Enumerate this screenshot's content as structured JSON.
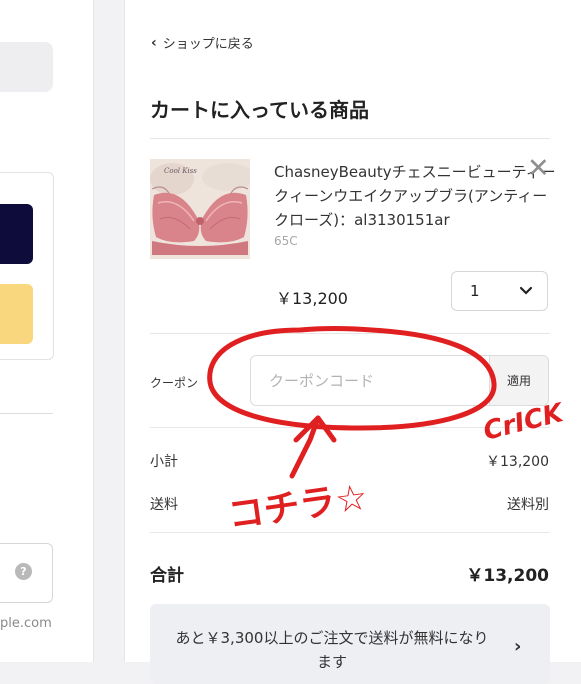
{
  "left_panel": {
    "help_symbol": "?",
    "domain_text": "ple.com"
  },
  "cart": {
    "back_link": "ショップに戻る",
    "title": "カートに入っている商品",
    "item": {
      "name": "ChasneyBeautyチェスニービューティークィーンウエイクアップブラ(アンティークローズ)：al3130151ar",
      "variant": "65C",
      "price": "￥13,200",
      "quantity": "1",
      "thumbnail_logo": "Cool Kiss"
    },
    "coupon": {
      "label": "クーポン",
      "placeholder": "クーポンコード",
      "apply_label": "適用"
    },
    "subtotal_label": "小計",
    "subtotal_value": "￥13,200",
    "shipping_label": "送料",
    "shipping_value": "送料別",
    "total_label": "合計",
    "total_value": "￥13,200",
    "notice": "あと￥3,300以上のご注文で送料が無料になります"
  },
  "annotation": {
    "click_text": "CrICK",
    "kochira_text": "コチラ☆",
    "color": "#e02020"
  }
}
